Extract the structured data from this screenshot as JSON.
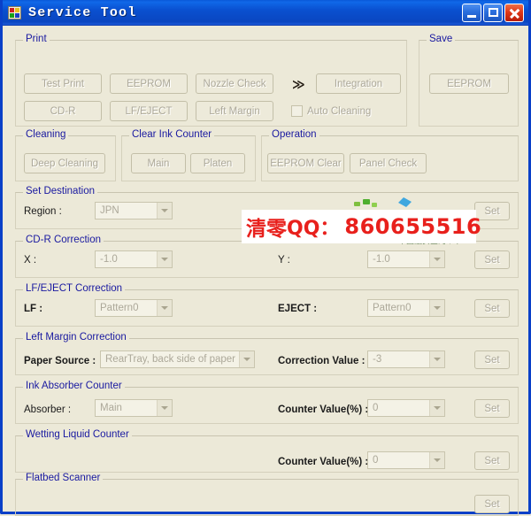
{
  "window": {
    "title": "Service Tool",
    "icon": "printer-app-icon",
    "controls": {
      "minimize": "Minimize",
      "maximize": "Maximize",
      "close": "Close"
    },
    "accent_color": "#0A50D0",
    "client_color": "#ECE9D8",
    "group_label_color": "#1919A0"
  },
  "groups": {
    "print": {
      "label": "Print",
      "buttons_row1": [
        "Test Print",
        "EEPROM",
        "Nozzle Check"
      ],
      "arrow": "≫",
      "integration": "Integration",
      "buttons_row2": [
        "CD-R",
        "LF/EJECT",
        "Left Margin"
      ],
      "auto_cleaning": "Auto Cleaning",
      "auto_cleaning_checked": false
    },
    "save": {
      "label": "Save",
      "button": "EEPROM"
    },
    "cleaning": {
      "label": "Cleaning",
      "button": "Deep Cleaning"
    },
    "clear_ink_counter": {
      "label": "Clear Ink Counter",
      "buttons": [
        "Main",
        "Platen"
      ]
    },
    "operation": {
      "label": "Operation",
      "buttons": [
        "EEPROM Clear",
        "Panel Check"
      ]
    },
    "set_destination": {
      "label": "Set Destination",
      "field_label": "Region :",
      "value": "JPN",
      "set": "Set"
    },
    "cdr_correction": {
      "label": "CD-R Correction",
      "x_label": "X :",
      "x_value": "-1.0",
      "y_label": "Y :",
      "y_value": "-1.0",
      "set": "Set"
    },
    "lf_eject_correction": {
      "label": "LF/EJECT Correction",
      "lf_label": "LF :",
      "lf_value": "Pattern0",
      "eject_label": "EJECT :",
      "eject_value": "Pattern0",
      "set": "Set"
    },
    "left_margin_correction": {
      "label": "Left Margin Correction",
      "paper_source_label": "Paper Source :",
      "paper_source_value": "RearTray, back side of paper",
      "correction_label": "Correction Value :",
      "correction_value": "-3",
      "set": "Set"
    },
    "ink_absorber_counter": {
      "label": "Ink Absorber Counter",
      "absorber_label": "Absorber :",
      "absorber_value": "Main",
      "counter_label": "Counter Value(%) :",
      "counter_value": "0",
      "set": "Set"
    },
    "wetting_liquid_counter": {
      "label": "Wetting Liquid Counter",
      "counter_label": "Counter Value(%) :",
      "counter_value": "0",
      "set": "Set"
    },
    "flatbed_scanner": {
      "label": "Flatbed Scanner",
      "set": "Set"
    }
  },
  "watermark": {
    "chinese": "清零",
    "qq": "QQ：",
    "number": "860655516",
    "color": "#E8201C",
    "logo_caption": "中国最安全的个载站"
  }
}
